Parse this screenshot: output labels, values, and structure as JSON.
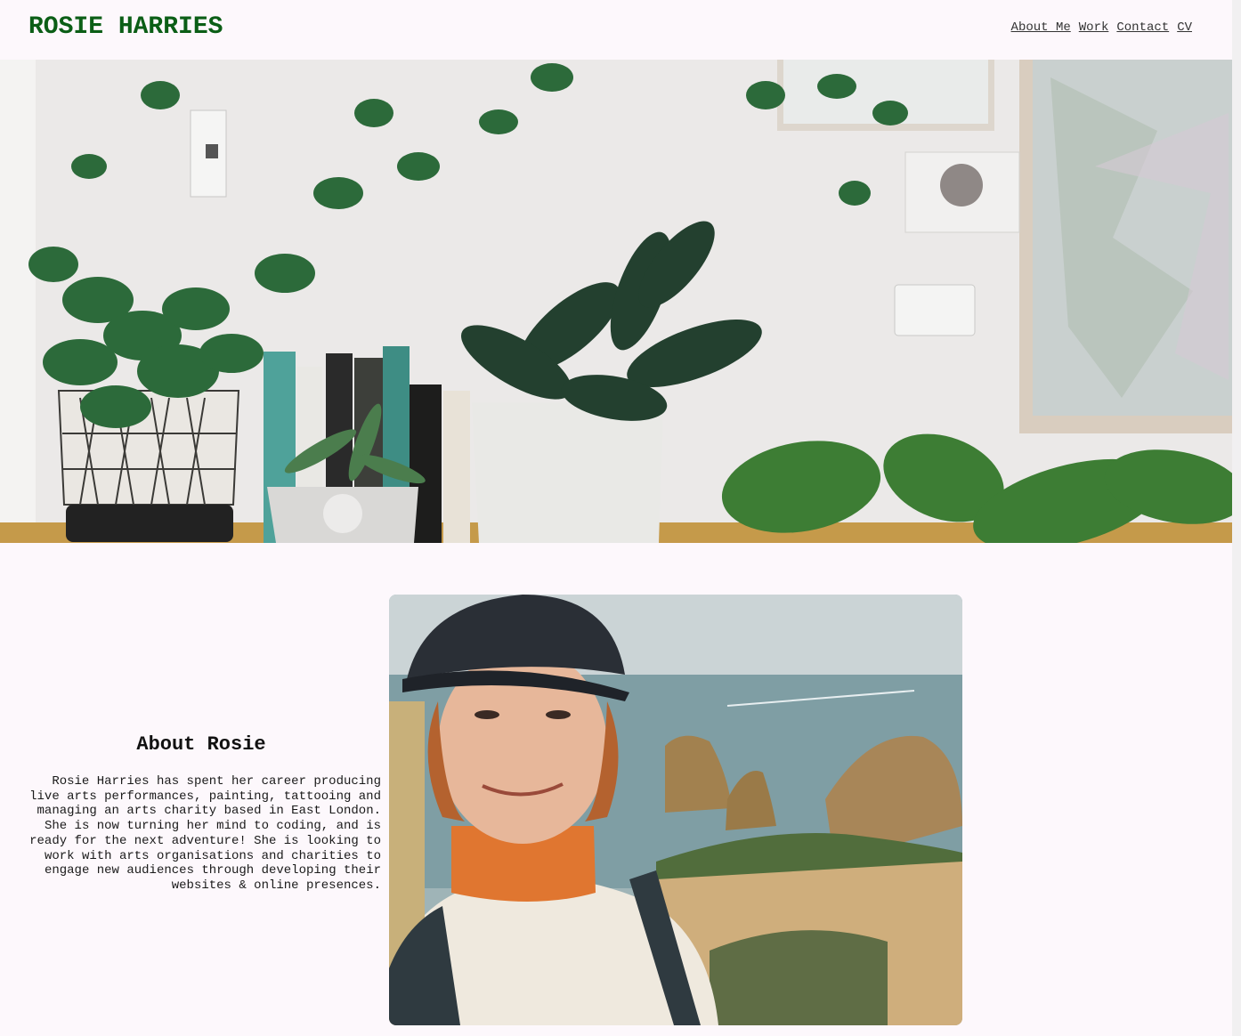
{
  "header": {
    "brand": "ROSIE HARRIES",
    "nav": [
      {
        "label": "About Me"
      },
      {
        "label": "Work"
      },
      {
        "label": "Contact"
      },
      {
        "label": "CV"
      }
    ]
  },
  "about": {
    "heading": "About Rosie",
    "body": "Rosie Harries has spent her career producing live arts performances, painting, tattooing and managing an arts charity based in East London. She is now turning her mind to coding, and is ready for the next adventure! She is looking to work with arts organisations and charities to engage new audiences through developing their websites & online presences."
  },
  "colors": {
    "brand": "#0b5e16",
    "background": "#fdf8fc",
    "link": "#333333"
  }
}
